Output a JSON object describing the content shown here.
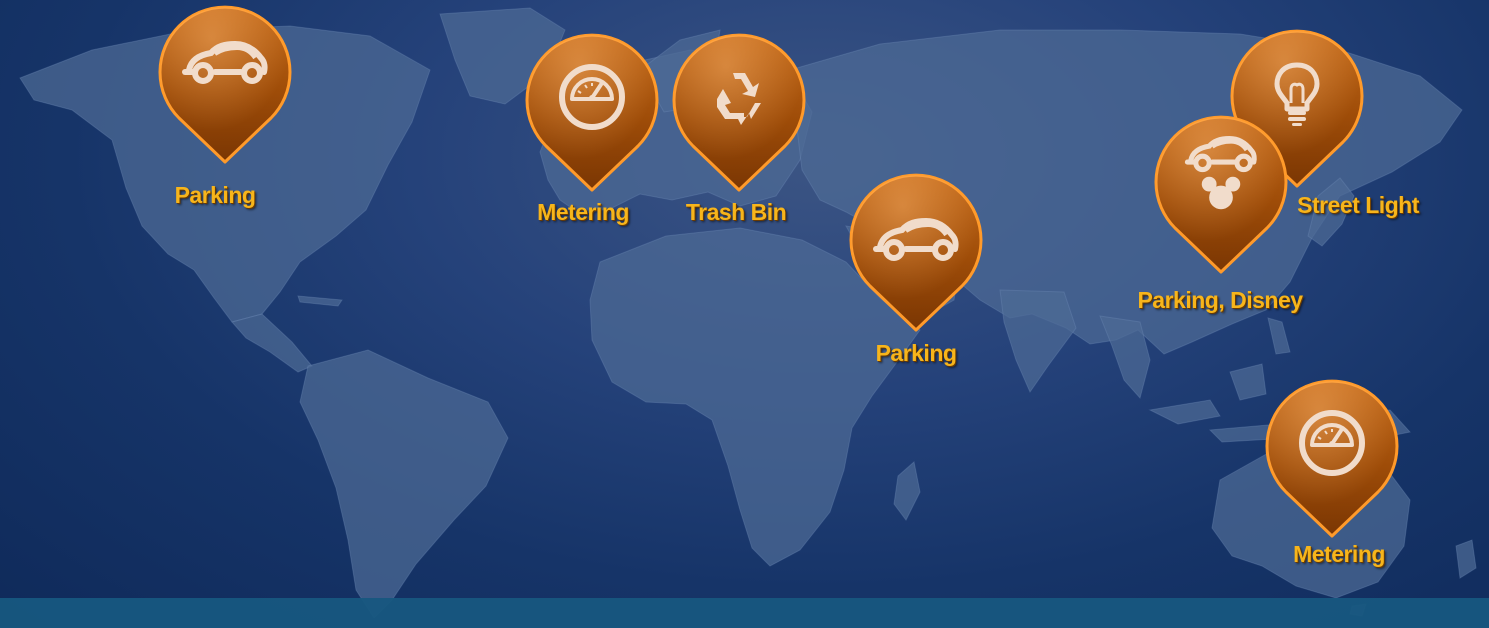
{
  "theme": {
    "pin_color": "#9e4c08",
    "pin_edge": "#ff9a2a",
    "label_color": "#f7b51b",
    "icon_color": "#f1dccb",
    "land_color": "#4d6b95",
    "background": "#163468"
  },
  "markers": [
    {
      "id": "parking-north-america",
      "icon": "car-icon",
      "label": "Parking"
    },
    {
      "id": "metering-europe",
      "icon": "speedometer-icon",
      "label": "Metering"
    },
    {
      "id": "trash-bin-europe",
      "icon": "recycle-icon",
      "label": "Trash Bin"
    },
    {
      "id": "parking-middle-east",
      "icon": "car-icon",
      "label": "Parking"
    },
    {
      "id": "street-light-east-asia",
      "icon": "lightbulb-icon",
      "label": "Street Light"
    },
    {
      "id": "parking-disney-china",
      "icon": "car-icon",
      "icon2": "mickey-icon",
      "label": "Parking, Disney"
    },
    {
      "id": "metering-australia",
      "icon": "speedometer-icon",
      "label": "Metering"
    }
  ]
}
